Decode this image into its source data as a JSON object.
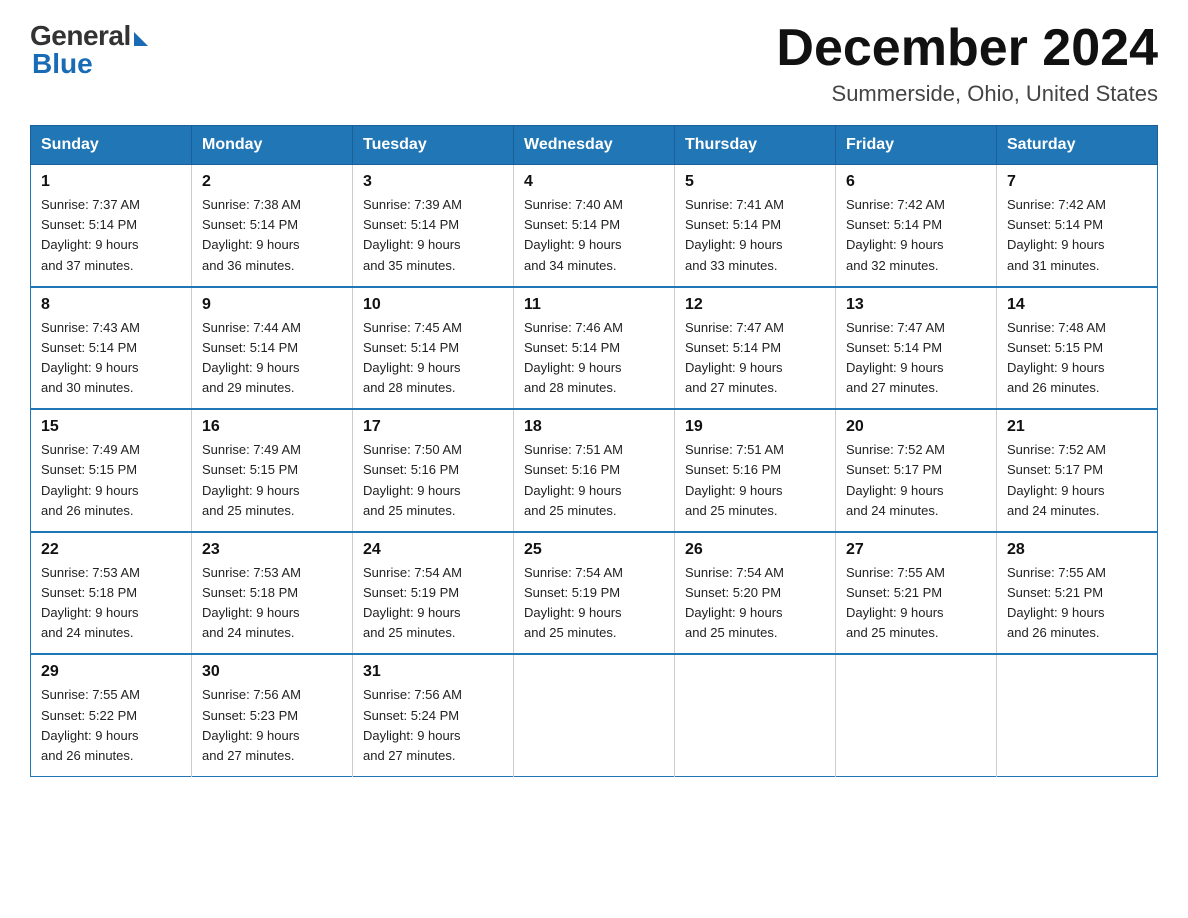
{
  "header": {
    "logo_general": "General",
    "logo_blue": "Blue",
    "month_title": "December 2024",
    "location": "Summerside, Ohio, United States"
  },
  "days_of_week": [
    "Sunday",
    "Monday",
    "Tuesday",
    "Wednesday",
    "Thursday",
    "Friday",
    "Saturday"
  ],
  "weeks": [
    [
      {
        "day": "1",
        "sunrise": "7:37 AM",
        "sunset": "5:14 PM",
        "daylight": "9 hours and 37 minutes."
      },
      {
        "day": "2",
        "sunrise": "7:38 AM",
        "sunset": "5:14 PM",
        "daylight": "9 hours and 36 minutes."
      },
      {
        "day": "3",
        "sunrise": "7:39 AM",
        "sunset": "5:14 PM",
        "daylight": "9 hours and 35 minutes."
      },
      {
        "day": "4",
        "sunrise": "7:40 AM",
        "sunset": "5:14 PM",
        "daylight": "9 hours and 34 minutes."
      },
      {
        "day": "5",
        "sunrise": "7:41 AM",
        "sunset": "5:14 PM",
        "daylight": "9 hours and 33 minutes."
      },
      {
        "day": "6",
        "sunrise": "7:42 AM",
        "sunset": "5:14 PM",
        "daylight": "9 hours and 32 minutes."
      },
      {
        "day": "7",
        "sunrise": "7:42 AM",
        "sunset": "5:14 PM",
        "daylight": "9 hours and 31 minutes."
      }
    ],
    [
      {
        "day": "8",
        "sunrise": "7:43 AM",
        "sunset": "5:14 PM",
        "daylight": "9 hours and 30 minutes."
      },
      {
        "day": "9",
        "sunrise": "7:44 AM",
        "sunset": "5:14 PM",
        "daylight": "9 hours and 29 minutes."
      },
      {
        "day": "10",
        "sunrise": "7:45 AM",
        "sunset": "5:14 PM",
        "daylight": "9 hours and 28 minutes."
      },
      {
        "day": "11",
        "sunrise": "7:46 AM",
        "sunset": "5:14 PM",
        "daylight": "9 hours and 28 minutes."
      },
      {
        "day": "12",
        "sunrise": "7:47 AM",
        "sunset": "5:14 PM",
        "daylight": "9 hours and 27 minutes."
      },
      {
        "day": "13",
        "sunrise": "7:47 AM",
        "sunset": "5:14 PM",
        "daylight": "9 hours and 27 minutes."
      },
      {
        "day": "14",
        "sunrise": "7:48 AM",
        "sunset": "5:15 PM",
        "daylight": "9 hours and 26 minutes."
      }
    ],
    [
      {
        "day": "15",
        "sunrise": "7:49 AM",
        "sunset": "5:15 PM",
        "daylight": "9 hours and 26 minutes."
      },
      {
        "day": "16",
        "sunrise": "7:49 AM",
        "sunset": "5:15 PM",
        "daylight": "9 hours and 25 minutes."
      },
      {
        "day": "17",
        "sunrise": "7:50 AM",
        "sunset": "5:16 PM",
        "daylight": "9 hours and 25 minutes."
      },
      {
        "day": "18",
        "sunrise": "7:51 AM",
        "sunset": "5:16 PM",
        "daylight": "9 hours and 25 minutes."
      },
      {
        "day": "19",
        "sunrise": "7:51 AM",
        "sunset": "5:16 PM",
        "daylight": "9 hours and 25 minutes."
      },
      {
        "day": "20",
        "sunrise": "7:52 AM",
        "sunset": "5:17 PM",
        "daylight": "9 hours and 24 minutes."
      },
      {
        "day": "21",
        "sunrise": "7:52 AM",
        "sunset": "5:17 PM",
        "daylight": "9 hours and 24 minutes."
      }
    ],
    [
      {
        "day": "22",
        "sunrise": "7:53 AM",
        "sunset": "5:18 PM",
        "daylight": "9 hours and 24 minutes."
      },
      {
        "day": "23",
        "sunrise": "7:53 AM",
        "sunset": "5:18 PM",
        "daylight": "9 hours and 24 minutes."
      },
      {
        "day": "24",
        "sunrise": "7:54 AM",
        "sunset": "5:19 PM",
        "daylight": "9 hours and 25 minutes."
      },
      {
        "day": "25",
        "sunrise": "7:54 AM",
        "sunset": "5:19 PM",
        "daylight": "9 hours and 25 minutes."
      },
      {
        "day": "26",
        "sunrise": "7:54 AM",
        "sunset": "5:20 PM",
        "daylight": "9 hours and 25 minutes."
      },
      {
        "day": "27",
        "sunrise": "7:55 AM",
        "sunset": "5:21 PM",
        "daylight": "9 hours and 25 minutes."
      },
      {
        "day": "28",
        "sunrise": "7:55 AM",
        "sunset": "5:21 PM",
        "daylight": "9 hours and 26 minutes."
      }
    ],
    [
      {
        "day": "29",
        "sunrise": "7:55 AM",
        "sunset": "5:22 PM",
        "daylight": "9 hours and 26 minutes."
      },
      {
        "day": "30",
        "sunrise": "7:56 AM",
        "sunset": "5:23 PM",
        "daylight": "9 hours and 27 minutes."
      },
      {
        "day": "31",
        "sunrise": "7:56 AM",
        "sunset": "5:24 PM",
        "daylight": "9 hours and 27 minutes."
      },
      null,
      null,
      null,
      null
    ]
  ],
  "labels": {
    "sunrise": "Sunrise:",
    "sunset": "Sunset:",
    "daylight": "Daylight:"
  }
}
